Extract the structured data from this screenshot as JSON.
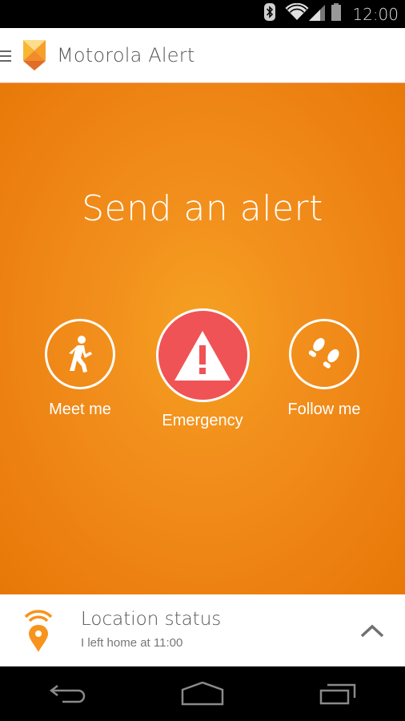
{
  "status_bar": {
    "time": "12:00",
    "icons": [
      "bluetooth-icon",
      "wifi-icon",
      "signal-icon",
      "battery-icon"
    ]
  },
  "app_bar": {
    "menu_icon": "hamburger-menu-icon",
    "logo_icon": "motorola-alert-logo",
    "title": "Motorola Alert"
  },
  "main": {
    "headline": "Send an alert",
    "background_color": "#ec8010",
    "actions": [
      {
        "id": "meet-me",
        "label": "Meet me",
        "icon": "walking-person-icon"
      },
      {
        "id": "emergency",
        "label": "Emergency",
        "icon": "warning-triangle-icon",
        "color": "#f05355"
      },
      {
        "id": "follow-me",
        "label": "Follow me",
        "icon": "footprints-icon"
      }
    ]
  },
  "location_panel": {
    "icon": "location-broadcast-icon",
    "title": "Location status",
    "subtitle": "I left home at 11:00",
    "expand_icon": "chevron-up-icon",
    "accent_color": "#f7941d"
  },
  "nav_bar": {
    "buttons": [
      "back",
      "home",
      "recent-apps"
    ]
  }
}
